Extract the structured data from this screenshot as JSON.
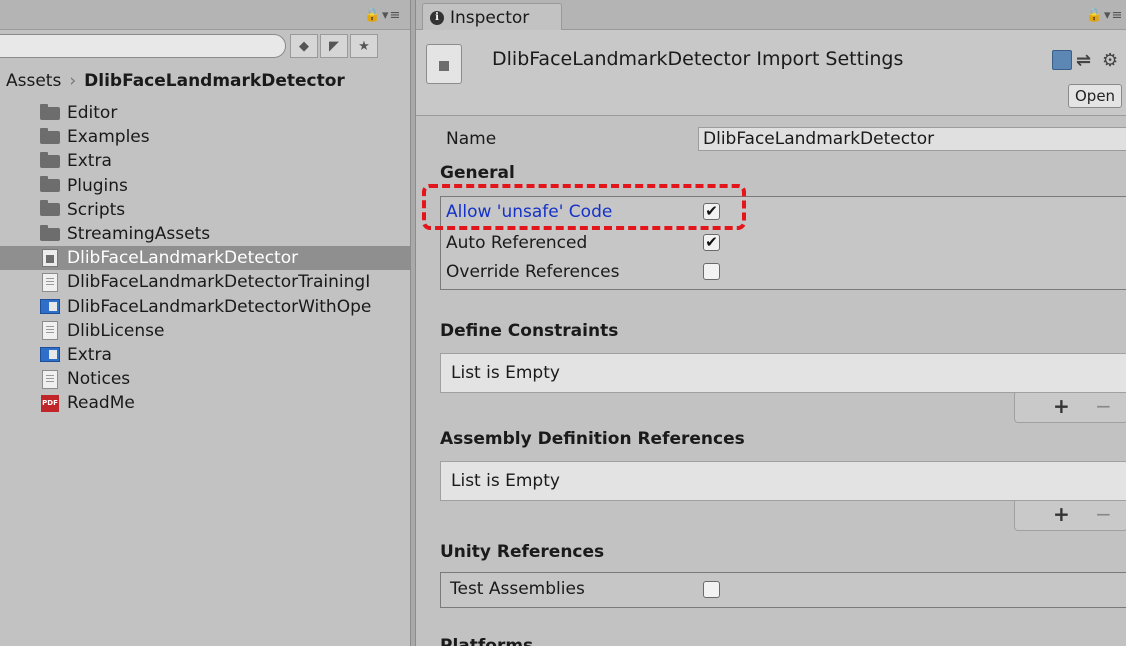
{
  "project": {
    "search": {
      "value": "",
      "placeholder": ""
    },
    "breadcrumb": {
      "root": "Assets",
      "separator": "›",
      "current": "DlibFaceLandmarkDetector"
    },
    "items": [
      {
        "label": "Editor",
        "icon": "folder-icon",
        "selected": false
      },
      {
        "label": "Examples",
        "icon": "folder-icon",
        "selected": false
      },
      {
        "label": "Extra",
        "icon": "folder-icon",
        "selected": false
      },
      {
        "label": "Plugins",
        "icon": "folder-icon",
        "selected": false
      },
      {
        "label": "Scripts",
        "icon": "folder-icon",
        "selected": false
      },
      {
        "label": "StreamingAssets",
        "icon": "folder-icon",
        "selected": false
      },
      {
        "label": "DlibFaceLandmarkDetector",
        "icon": "assembly-definition-icon",
        "selected": true
      },
      {
        "label": "DlibFaceLandmarkDetectorTrainingI",
        "icon": "text-document-icon",
        "selected": false
      },
      {
        "label": "DlibFaceLandmarkDetectorWithOpe",
        "icon": "asset-blue-icon",
        "selected": false
      },
      {
        "label": "DlibLicense",
        "icon": "text-document-icon",
        "selected": false
      },
      {
        "label": "Extra",
        "icon": "asset-blue-icon",
        "selected": false
      },
      {
        "label": "Notices",
        "icon": "text-document-icon",
        "selected": false
      },
      {
        "label": "ReadMe",
        "icon": "pdf-icon",
        "selected": false
      }
    ],
    "pdf_icon_text": "PDF"
  },
  "inspector": {
    "tab_label": "Inspector",
    "info_glyph": "i",
    "title": "DlibFaceLandmarkDetector Import Settings",
    "open_label": "Open",
    "name_label": "Name",
    "name_value": "DlibFaceLandmarkDetector",
    "general_title": "General",
    "options": [
      {
        "label": "Allow 'unsafe' Code",
        "checked": true,
        "highlighted": true
      },
      {
        "label": "Auto Referenced",
        "checked": true,
        "highlighted": false
      },
      {
        "label": "Override References",
        "checked": false,
        "highlighted": false
      }
    ],
    "define_constraints_title": "Define Constraints",
    "define_constraints_empty": "List is Empty",
    "assembly_refs_title": "Assembly Definition References",
    "assembly_refs_empty": "List is Empty",
    "unity_refs_title": "Unity References",
    "test_assemblies_label": "Test Assemblies",
    "test_assemblies_checked": false,
    "platforms_title": "Platforms"
  },
  "colors": {
    "highlight_border": "#e3141a",
    "link_text": "#1432c8",
    "selected_row": "#8f8f8f"
  }
}
